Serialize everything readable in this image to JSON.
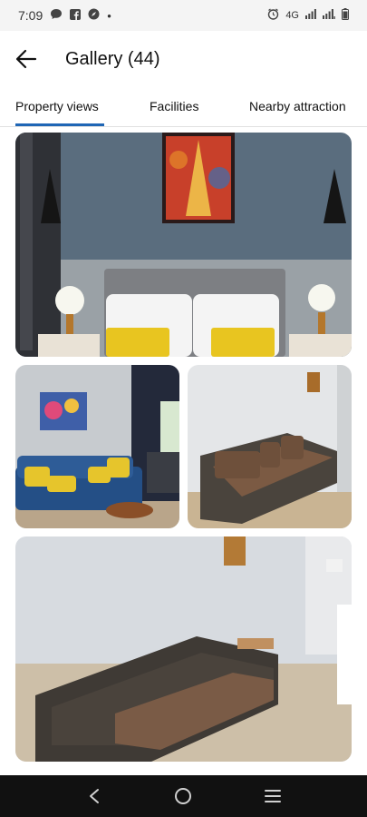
{
  "status_bar": {
    "time": "7:09",
    "dot": "•",
    "network": "4G",
    "left_icons": [
      "chat-bubble-icon",
      "facebook-icon",
      "compass-icon"
    ],
    "right_icons": [
      "alarm-icon",
      "signal-4g-icon",
      "signal-icon",
      "battery-icon"
    ]
  },
  "header": {
    "back_icon": "back-arrow-icon",
    "title": "Gallery (44)"
  },
  "tabs": [
    {
      "label": "Property views",
      "selected": true
    },
    {
      "label": "Facilities",
      "selected": false
    },
    {
      "label": "Nearby attraction",
      "selected": false
    }
  ],
  "accent_color": "#1f66b5",
  "gallery": {
    "photos": [
      {
        "subject": "bedroom-photo"
      },
      {
        "subject": "living-room-blue-sofa-photo"
      },
      {
        "subject": "wicker-sofa-photo"
      },
      {
        "subject": "wicker-sofa-wide-photo"
      }
    ]
  },
  "nav_bar": {
    "icons": [
      "nav-back-icon",
      "nav-home-icon",
      "nav-recents-icon"
    ]
  }
}
